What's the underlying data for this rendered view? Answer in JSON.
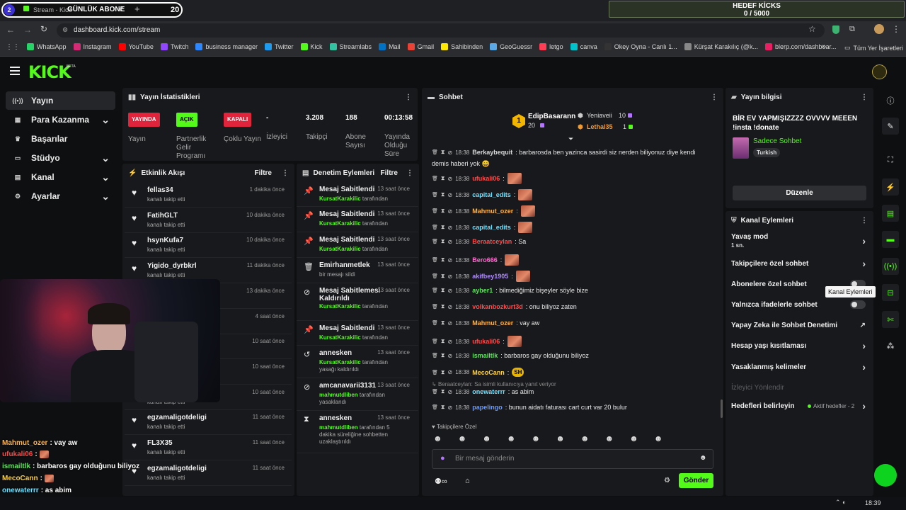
{
  "browser": {
    "tab_title": "Stream - Kick",
    "overlay_goal_label": "GÜNLÜK ABONE",
    "overlay_goal_value": "20",
    "overlay_left_num": "2",
    "url": "dashboard.kick.com/stream",
    "kicks_goal_label": "HEDEF KİCKS",
    "kicks_goal_value": "0 / 5000",
    "bookmarks": [
      "WhatsApp",
      "Instagram",
      "YouTube",
      "Twitch",
      "business manager",
      "Twitter",
      "Kick",
      "Streamlabs",
      "Mail",
      "Gmail",
      "Sahibinden",
      "GeoGuessr",
      "letgo",
      "canva",
      "Okey Oyna - Canlı 1...",
      "Kürşat Karakılıç (@k...",
      "blerp.com/dashboar..."
    ],
    "bookmarks_folder": "Tüm Yer İşaretleri",
    "bookmark_colors": [
      "#25d366",
      "#d62976",
      "#ff0000",
      "#9146ff",
      "#2d88ff",
      "#1d9bf0",
      "#53fc18",
      "#31c3a2",
      "#0072c6",
      "#ea4335",
      "#ffe800",
      "#5aa9e6",
      "#ff3e55",
      "#00c4cc",
      "#333333",
      "#888888",
      "#e91e63"
    ]
  },
  "kick": {
    "logo": "KICK",
    "logo_sup": "BETA"
  },
  "sidebar": {
    "items": [
      {
        "label": "Yayın",
        "icon": "broadcast-icon",
        "expand": false
      },
      {
        "label": "Para Kazanma",
        "icon": "money-icon",
        "expand": true
      },
      {
        "label": "Başarılar",
        "icon": "trophy-icon",
        "expand": false
      },
      {
        "label": "Stüdyo",
        "icon": "studio-icon",
        "expand": true
      },
      {
        "label": "Kanal",
        "icon": "channel-icon",
        "expand": true
      },
      {
        "label": "Ayarlar",
        "icon": "settings-icon",
        "expand": true
      }
    ]
  },
  "stats": {
    "title": "Yayın İstatistikleri",
    "badges": [
      {
        "badge": "YAYINDA",
        "label": "Yayın",
        "color": "#e0243c"
      },
      {
        "badge": "AÇIK",
        "label": "Partnerlik Gelir Programı",
        "color": "#53fc18"
      },
      {
        "badge": "KAPALI",
        "label": "Çoklu Yayın",
        "color": "#e0243c"
      }
    ],
    "values": [
      {
        "value": "-",
        "label": "İzleyici"
      },
      {
        "value": "3.208",
        "label": "Takipçi"
      },
      {
        "value": "188",
        "label": "Abone Sayısı"
      },
      {
        "value": "00:13:58",
        "label": "Yayında Olduğu Süre"
      }
    ]
  },
  "activity": {
    "title": "Etkinlik Akışı",
    "filter": "Filtre",
    "items": [
      {
        "name": "fellas34",
        "sub": "kanalı takip etti",
        "time": "1 dakika önce"
      },
      {
        "name": "FatihGLT",
        "sub": "kanalı takip etti",
        "time": "10 dakika önce"
      },
      {
        "name": "hsynKufa7",
        "sub": "kanalı takip etti",
        "time": "10 dakika önce"
      },
      {
        "name": "Yigido_dyrbkrl",
        "sub": "kanalı takip etti",
        "time": "11 dakika önce"
      },
      {
        "name": "",
        "sub": "",
        "time": "13 dakika önce"
      },
      {
        "name": "",
        "sub": "",
        "time": "4 saat önce"
      },
      {
        "name": "",
        "sub": "",
        "time": "10 saat önce"
      },
      {
        "name": "",
        "sub": "",
        "time": "10 saat önce"
      },
      {
        "name": "",
        "sub": "kanalı takip etti",
        "time": "10 saat önce"
      },
      {
        "name": "egzamaligotdeligi",
        "sub": "kanalı takip etti",
        "time": "11 saat önce"
      },
      {
        "name": "FL3X35",
        "sub": "kanalı takip etti",
        "time": "11 saat önce"
      },
      {
        "name": "egzamaligotdeligi",
        "sub": "kanalı takip etti",
        "time": "11 saat önce"
      }
    ]
  },
  "moderation": {
    "title": "Denetim Eylemleri",
    "filter": "Filtre",
    "items": [
      {
        "icon": "pin-icon",
        "glyph": "📌",
        "name": "Mesaj Sabitlendi",
        "user": "KursatKarakilic",
        "rest": " tarafından",
        "time": "13 saat önce"
      },
      {
        "icon": "pin-icon",
        "glyph": "📌",
        "name": "Mesaj Sabitlendi",
        "user": "KursatKarakilic",
        "rest": " tarafından",
        "time": "13 saat önce"
      },
      {
        "icon": "pin-icon",
        "glyph": "📌",
        "name": "Mesaj Sabitlendi",
        "user": "KursatKarakilic",
        "rest": " tarafından",
        "time": "13 saat önce"
      },
      {
        "icon": "trash-icon",
        "glyph": "🗑",
        "name": "Emirhanmetlek",
        "user": "",
        "rest": "bir mesajı sildi",
        "time": "13 saat önce"
      },
      {
        "icon": "unpin-icon",
        "glyph": "⊘",
        "name": "Mesaj Sabitlemesi Kaldırıldı",
        "user": "KursatKarakilic",
        "rest": " tarafından",
        "time": "13 saat önce"
      },
      {
        "icon": "pin-icon",
        "glyph": "📌",
        "name": "Mesaj Sabitlendi",
        "user": "KursatKarakilic",
        "rest": " tarafından",
        "time": "13 saat önce"
      },
      {
        "icon": "undo-icon",
        "glyph": "↺",
        "name": "annesken",
        "user": "KursatKarakilic",
        "rest": " tarafından yasağı kaldırıldı",
        "time": "13 saat önce"
      },
      {
        "icon": "ban-icon",
        "glyph": "⊘",
        "name": "amcanavarii3131",
        "user": "mahmutdliben",
        "rest": " tarafından yasaklandı",
        "time": "13 saat önce"
      },
      {
        "icon": "timeout-icon",
        "glyph": "⧗",
        "name": "annesken",
        "user": "mahmutdliben",
        "rest": " tarafından 5 dakika süreliğine sohbetten uzaklaştırıldı",
        "time": "13 saat önce"
      }
    ]
  },
  "chat": {
    "title": "Sohbet",
    "top_gifters": [
      {
        "name": "EdipBasarann",
        "count": "20"
      },
      {
        "name": "Yeniaveii",
        "count": "10"
      },
      {
        "name": "Lethal35",
        "count": "1"
      }
    ],
    "messages": [
      {
        "time": "18:38",
        "user": "Berkaybequit",
        "color": "#d9d9d9",
        "text": ": barbarosda ben yazinca sasirdi siz nerden biliyonuz diye kendi",
        "cont": "demis haberi yok 😄",
        "emote": false
      },
      {
        "time": "18:38",
        "user": "ufukali06",
        "color": "#ff4b4b",
        "text": ":",
        "emote": true
      },
      {
        "time": "18:38",
        "user": "capital_edits",
        "color": "#6be1ff",
        "text": ":",
        "emote": true
      },
      {
        "time": "18:38",
        "user": "Mahmut_ozer",
        "color": "#ffb347",
        "text": ":",
        "emote": true
      },
      {
        "time": "18:38",
        "user": "capital_edits",
        "color": "#6be1ff",
        "text": ":",
        "emote": true
      },
      {
        "time": "18:38",
        "user": "Beraatceylan",
        "color": "#ff4b4b",
        "text": ": Sa",
        "emote": false
      },
      {
        "time": "18:38",
        "user": "Bero666",
        "color": "#ff6bd0",
        "text": ":",
        "emote": true
      },
      {
        "time": "18:38",
        "user": "akifbey1905",
        "color": "#b08cff",
        "text": ":",
        "emote": true
      },
      {
        "time": "18:38",
        "user": "ayber1",
        "color": "#5fe35f",
        "text": ": bilmediğimiz bişeyler söyle bize",
        "emote": false
      },
      {
        "time": "18:38",
        "user": "volkanbozkurt3d",
        "color": "#ff4b4b",
        "text": ": onu biliyoz zaten",
        "emote": false
      },
      {
        "time": "18:38",
        "user": "Mahmut_ozer",
        "color": "#ffb347",
        "text": ": vay aw",
        "emote": false
      },
      {
        "time": "18:38",
        "user": "ufukali06",
        "color": "#ff4b4b",
        "text": ":",
        "emote": true
      },
      {
        "time": "18:38",
        "user": "ismailtlk",
        "color": "#5fe35f",
        "text": ": barbaros gay olduğunu biliyoz",
        "emote": false
      },
      {
        "time": "18:38",
        "user": "MecoCann",
        "color": "#ffd23f",
        "text": ":",
        "emote": false,
        "sh": "SH"
      },
      {
        "time": "18:38",
        "user": "onewaterrr",
        "color": "#6be1ff",
        "text": ": as abim",
        "emote": false
      },
      {
        "time": "18:38",
        "user": "papelingo",
        "color": "#6b9bff",
        "text": ": bunun aidatı faturası cart curt var 20 bulur",
        "emote": false
      }
    ],
    "reply_note": "Beraatceylan: Sa isimli kullanıcıya yanıt veriyor",
    "followers_only": "Takipçilere Özel",
    "input_placeholder": "Bir mesaj gönderin",
    "send": "Gönder"
  },
  "stream_info": {
    "title": "Yayın bilgisi",
    "stream_title": "BİR EV YAPMIŞIZZZZ OVVVV MEEEN !insta !donate",
    "category": "Sadece Sohbet",
    "tag": "Turkish",
    "edit": "Düzenle"
  },
  "channel_actions": {
    "title": "Kanal Eylemleri",
    "items": [
      {
        "label": "Yavaş mod",
        "sub": "1 sn.",
        "control": "chevron"
      },
      {
        "label": "Takipçilere özel sohbet",
        "sub": "",
        "control": "chevron"
      },
      {
        "label": "Abonelere özel sohbet",
        "sub": "",
        "control": "toggle"
      },
      {
        "label": "Yalnızca ifadelerle sohbet",
        "sub": "",
        "control": "toggle"
      },
      {
        "label": "Yapay Zeka ile Sohbet Denetimi",
        "sub": "",
        "control": "external"
      },
      {
        "label": "Hesap yaşı kısıtlaması",
        "sub": "",
        "control": "chevron"
      },
      {
        "label": "Yasaklanmış kelimeler",
        "sub": "",
        "control": "chevron"
      },
      {
        "label": "İzleyici Yönlendir",
        "sub": "",
        "control": "none"
      },
      {
        "label": "Hedefleri belirleyin",
        "sub": "",
        "control": "chevron",
        "extra": "Aktif hedefler - 2"
      }
    ],
    "tooltip": "Kanal Eylemleri"
  },
  "overlay_chat": [
    {
      "user": "Mahmut_ozer",
      "color": "#ffb347",
      "text": ": vay aw"
    },
    {
      "user": "ufukali06",
      "color": "#ff4b4b",
      "text": ":"
    },
    {
      "user": "ismailtlk",
      "color": "#5fe35f",
      "text": ": barbaros gay olduğunu biliyoz"
    },
    {
      "user": "MecoCann",
      "color": "#ffd23f",
      "text": ":"
    },
    {
      "user": "onewaterrr",
      "color": "#6be1ff",
      "text": ": as abim"
    },
    {
      "user": "papelingo",
      "color": "#6b9bff",
      "text": ": bunun aidatı faturası cart curt var 20 bulur"
    }
  ],
  "taskbar": {
    "time": "18:39"
  }
}
